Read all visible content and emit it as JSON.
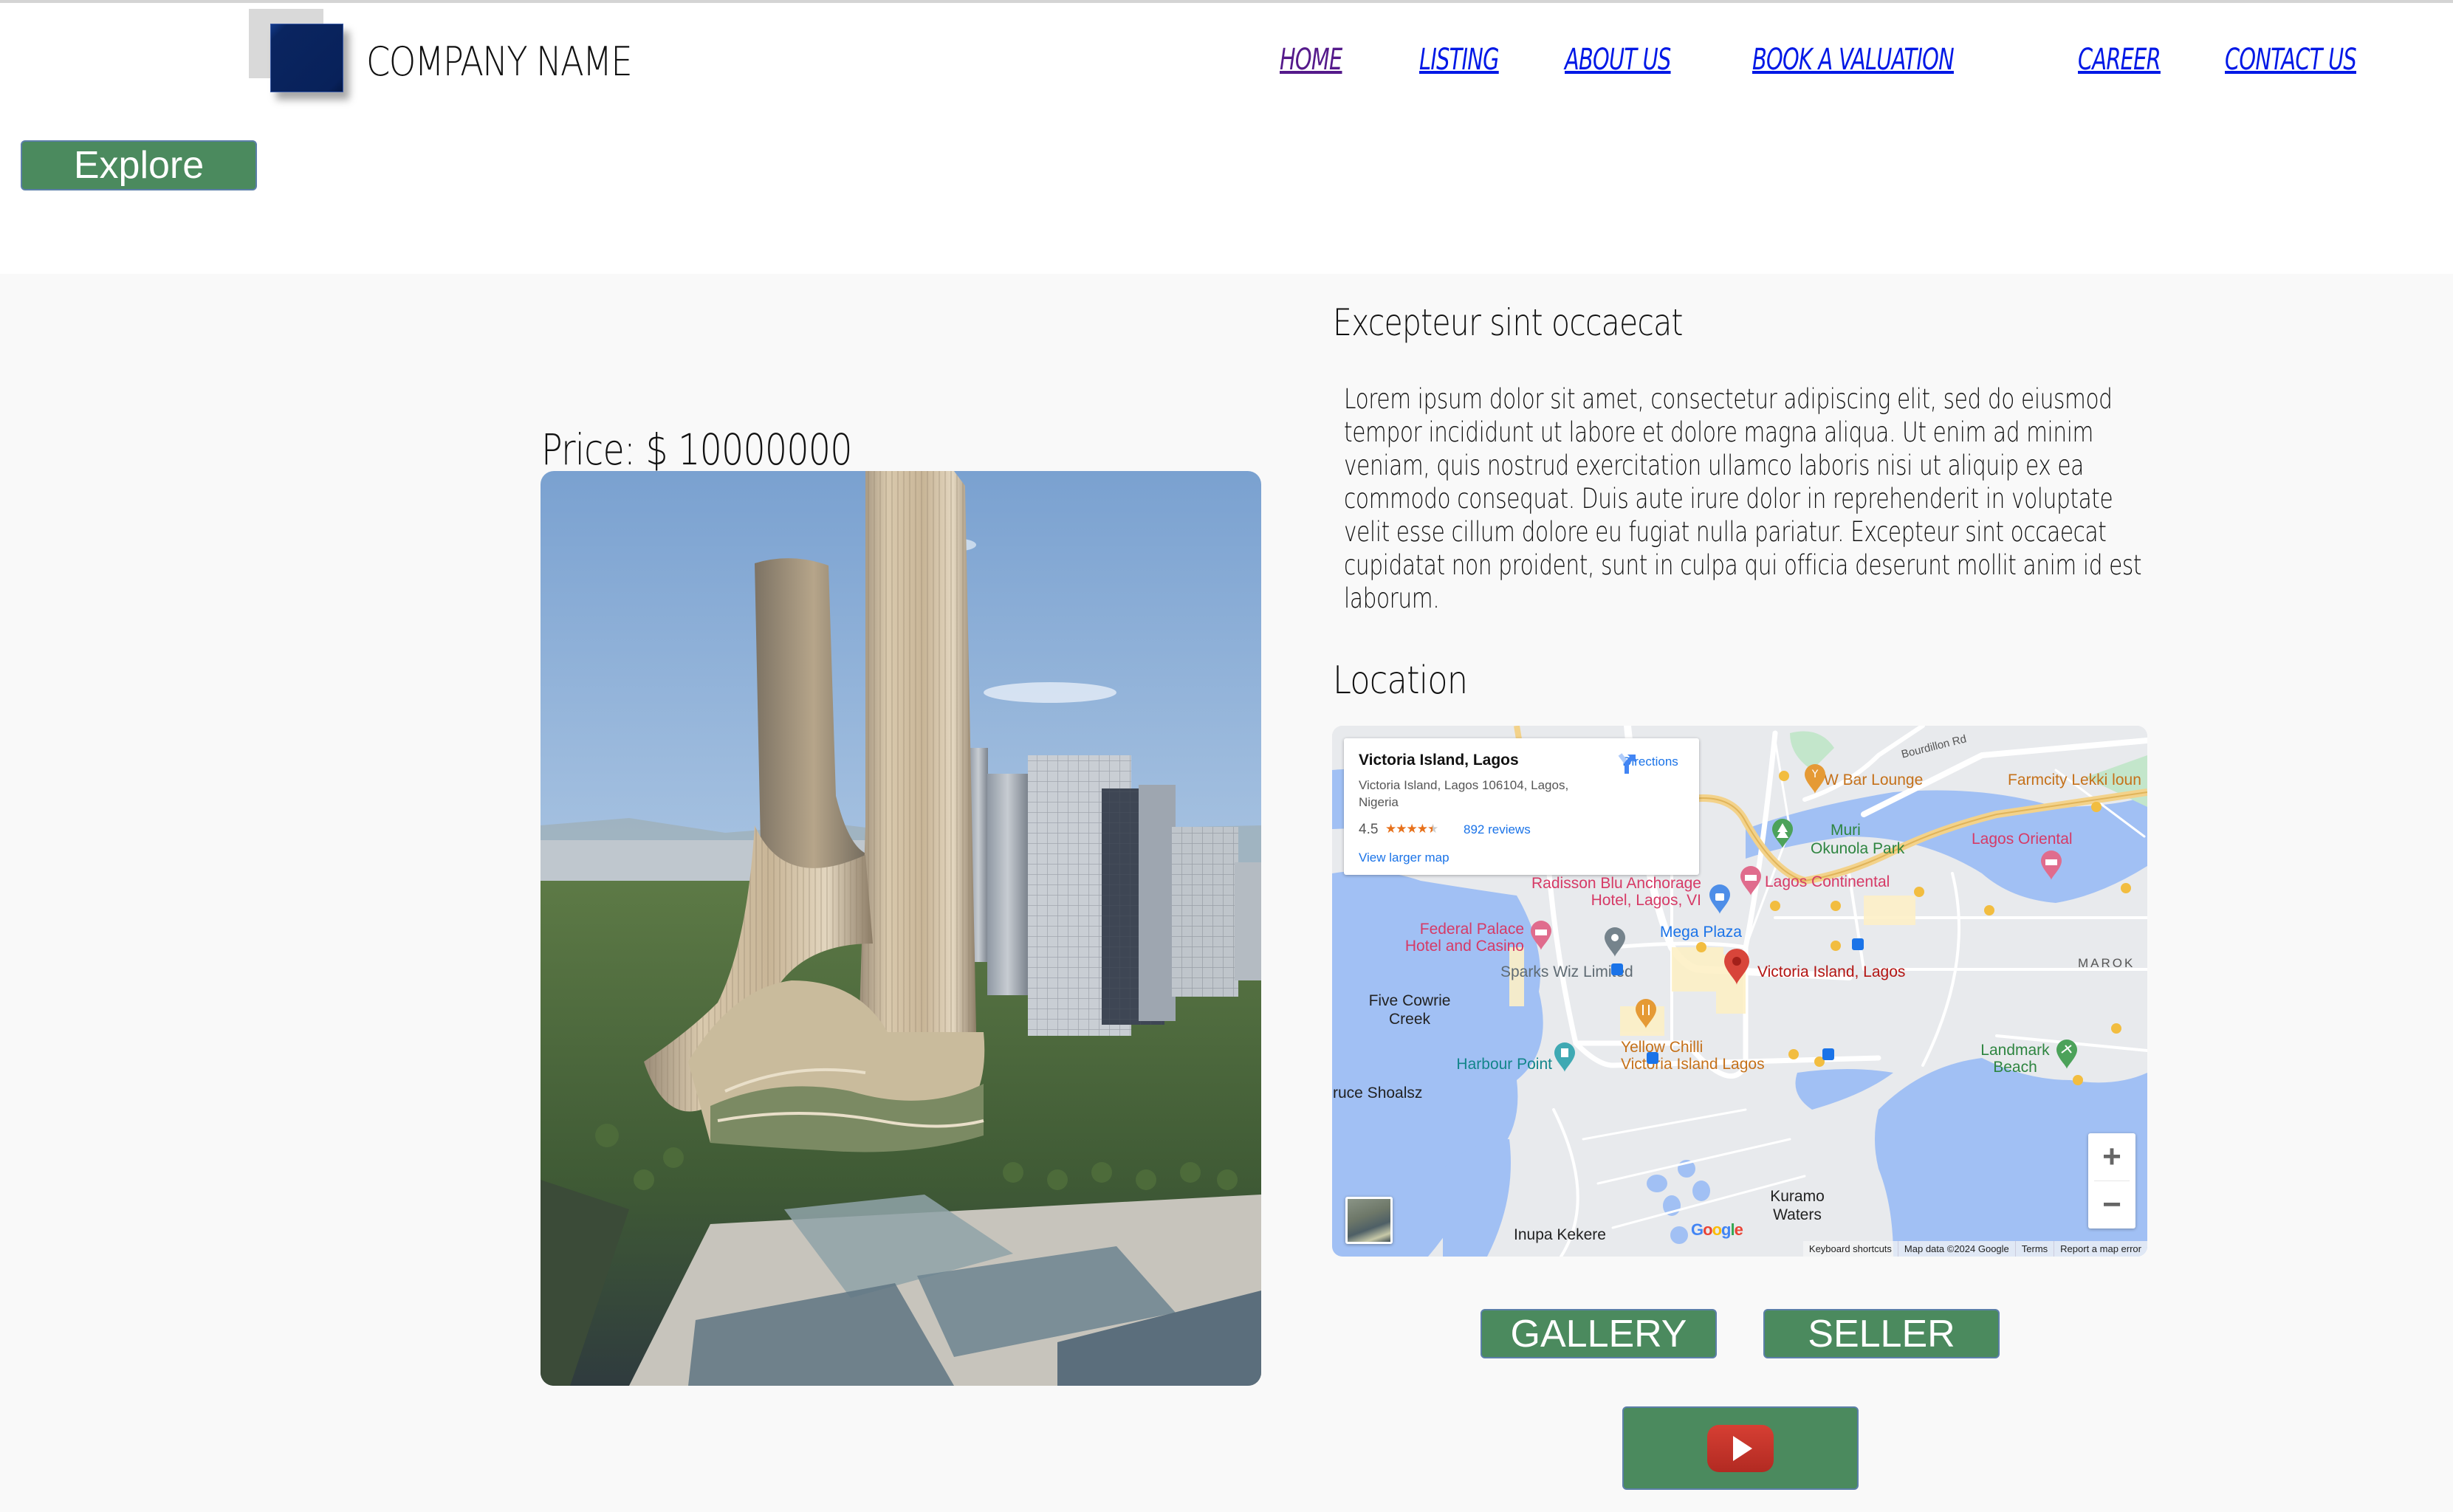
{
  "header": {
    "company_name": "COMPANY NAME",
    "nav": [
      {
        "label": "HOME",
        "visited": true
      },
      {
        "label": "LISTING",
        "visited": false
      },
      {
        "label": "ABOUT US",
        "visited": false
      },
      {
        "label": "BOOK A VALUATION",
        "visited": false
      },
      {
        "label": "CAREER",
        "visited": false
      },
      {
        "label": "CONTACT US",
        "visited": false
      }
    ],
    "explore_label": "Explore"
  },
  "listing": {
    "price_label": "Price: $ 10000000",
    "title": "Excepteur sint occaecat",
    "description": "Lorem ipsum dolor sit amet, consectetur adipiscing elit, sed do eiusmod tempor incididunt ut labore et dolore magna aliqua. Ut enim ad minim veniam, quis nostrud exercitation ullamco laboris nisi ut aliquip ex ea commodo consequat. Duis aute irure dolor in reprehenderit in voluptate velit esse cillum dolore eu fugiat nulla pariatur. Excepteur sint occaecat cupidatat non proident, sunt in culpa qui officia deserunt mollit anim id est laborum.",
    "location_heading": "Location",
    "photo_alt": "Futuristic twin-tower skyscraper"
  },
  "map": {
    "place_title": "Victoria Island, Lagos",
    "place_address": "Victoria Island, Lagos 106104, Lagos, Nigeria",
    "rating": "4.5",
    "stars": 4.5,
    "reviews_label": "892 reviews",
    "directions_label": "Directions",
    "view_larger_label": "View larger map",
    "zoom_in_label": "+",
    "zoom_out_label": "−",
    "attribution": [
      "Keyboard shortcuts",
      "Map data ©2024 Google",
      "Terms",
      "Report a map error"
    ],
    "google_logo": "Google",
    "labels": {
      "bourdillon": "Bourdillon Rd",
      "w_bar": "W Bar Lounge",
      "farmcity": "Farmcity Lekki loun",
      "muri_1": "Muri",
      "muri_2": "Okunola Park",
      "lagos_oriental": "Lagos Oriental",
      "lagos_continental": "Lagos Continental",
      "radisson_1": "Radisson Blu Anchorage",
      "radisson_2": "Hotel, Lagos, VI",
      "federal_1": "Federal Palace",
      "federal_2": "Hotel and Casino",
      "mega_plaza": "Mega Plaza",
      "sparks": "Sparks Wiz Limited",
      "victoria": "Victoria Island, Lagos",
      "maroko": "MAROK",
      "five_cowrie_1": "Five Cowrie",
      "five_cowrie_2": "Creek",
      "yellow_chilli_1": "Yellow Chilli",
      "yellow_chilli_2": "Victoria Island Lagos",
      "harbour_point": "Harbour Point",
      "landmark_1": "Landmark",
      "landmark_2": "Beach",
      "ruce_shoals": "ruce Shoalsz",
      "kuramo_1": "Kuramo",
      "kuramo_2": "Waters",
      "inupa": "Inupa Kekere"
    }
  },
  "actions": {
    "gallery_label": "GALLERY",
    "seller_label": "SELLER",
    "video_icon": "youtube-play-icon"
  },
  "colors": {
    "button_green": "#4b8a5e",
    "logo_blue": "#08215a",
    "link_blue": "#0018e6",
    "link_visited": "#551a8b",
    "map_water": "#a1c0f4",
    "band_bg": "#f9f9f9"
  }
}
